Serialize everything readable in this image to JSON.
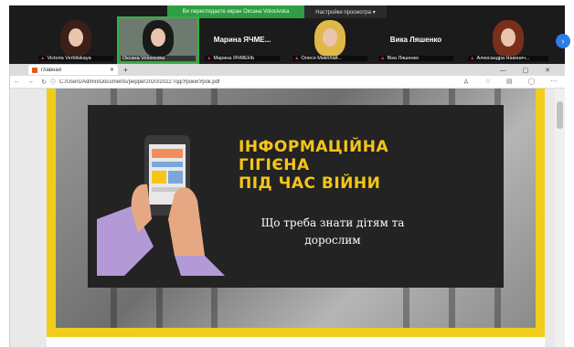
{
  "meeting": {
    "share_banner": "Ви переглядаєте екран Оксана Volosivska",
    "view_options": "Настройки просмотра ▾",
    "participants": [
      {
        "label": "Victoria Verbitskaya",
        "big_name": "",
        "hair": "#3b1f19",
        "bg": "#6b2a2a"
      },
      {
        "label": "Оксана Volosivska",
        "big_name": "",
        "hair": "#1a1a1a",
        "bg": "#6d7b6e"
      },
      {
        "label": "Марина ЯЧМЕНЬ",
        "big_name": "Марина ЯЧМЕ...",
        "hair": "",
        "bg": "#1b1b1b"
      },
      {
        "label": "Олеся Миколай...",
        "big_name": "",
        "hair": "#e0b84a",
        "bg": "#5a4a3a"
      },
      {
        "label": "Віка Ляшенко",
        "big_name": "Вика Ляшенко",
        "hair": "",
        "bg": "#1b1b1b"
      },
      {
        "label": "Александра Наконеч...",
        "big_name": "",
        "hair": "#7a2f1c",
        "bg": "#e6e6e6"
      }
    ],
    "next_page_icon": "chevron-right-icon"
  },
  "browser": {
    "tab_title": "главная",
    "url": "C:/Users/Admin/Documents/pepper2020/2022 год/Уроки/Урок.pdf",
    "window_controls": "— ▢ ✕"
  },
  "slide": {
    "title_lines": [
      "ІНФОРМАЦІЙНА",
      "ГІГІЄНА",
      "ПІД ЧАС ВІЙНИ"
    ],
    "subtitle": "Що треба знати дітям та дорослим",
    "colors": {
      "accent": "#f5c518",
      "card": "#232323",
      "frame": "#f2cc1a"
    }
  }
}
